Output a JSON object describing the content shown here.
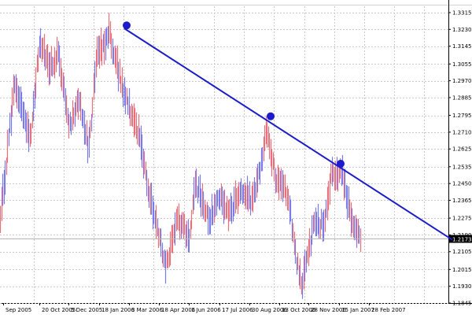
{
  "chart_data": {
    "type": "bar",
    "style": "ohlc-bars",
    "grid": true,
    "legend": "none",
    "colors": {
      "background": "#ffffff",
      "grid": "#c8c8c8",
      "up_bar": "#e8707a",
      "down_bar": "#7a7ae8",
      "trendline": "#1c1ccc",
      "marker": "#1c1ccc",
      "current_price_line": "#b4b4b4",
      "current_price_label_bg": "#000000",
      "current_price_label_fg": "#ffffff",
      "axis_text": "#000000"
    },
    "x_tick_labels": [
      "Sep 2005",
      "20 Oct 2005",
      "5 Dec 2005",
      "18 Jan 2006",
      "3 Mar 2006",
      "18 Apr 2006",
      "1 Jun 2006",
      "17 Jul 2006",
      "30 Aug 2006",
      "13 Oct 2006",
      "28 Nov 2006",
      "15 Jan 2007",
      "28 Feb 2007"
    ],
    "y_tick_labels": [
      "1.3315",
      "1.3230",
      "1.3145",
      "1.3055",
      "1.2970",
      "1.2885",
      "1.2795",
      "1.2710",
      "1.2625",
      "1.2535",
      "1.2450",
      "1.2365",
      "1.2275",
      "1.2190",
      "1.2105",
      "1.2015",
      "1.1930",
      "1.1845"
    ],
    "ylim": [
      1.1845,
      1.3315
    ],
    "current_price": "1.2173",
    "price_keyframes": [
      {
        "x": "Sep 2005",
        "y": 1.228
      },
      {
        "x": "Oct 2005",
        "y": 1.296
      },
      {
        "x": "20 Oct 2005",
        "y": 1.268
      },
      {
        "x": "Nov 2005",
        "y": 1.318
      },
      {
        "x": "Nov 2005",
        "y": 1.303
      },
      {
        "x": "5 Dec 2005",
        "y": 1.311
      },
      {
        "x": "Dec 2005",
        "y": 1.272
      },
      {
        "x": "Jan 2006",
        "y": 1.289
      },
      {
        "x": "18 Jan 2006",
        "y": 1.262
      },
      {
        "x": "Feb 2006",
        "y": 1.308
      },
      {
        "x": "3 Mar 2006",
        "y": 1.322
      },
      {
        "x": "Mar 2006",
        "y": 1.303
      },
      {
        "x": "Mar 2006",
        "y": 1.291
      },
      {
        "x": "Apr 2006",
        "y": 1.266
      },
      {
        "x": "Apr 2006",
        "y": 1.238
      },
      {
        "x": "18 Apr 2006",
        "y": 1.203
      },
      {
        "x": "May 2006",
        "y": 1.227
      },
      {
        "x": "May 2006",
        "y": 1.219
      },
      {
        "x": "1 Jun 2006",
        "y": 1.245
      },
      {
        "x": "Jun 2006",
        "y": 1.226
      },
      {
        "x": "Jul 2006",
        "y": 1.239
      },
      {
        "x": "17 Jul 2006",
        "y": 1.229
      },
      {
        "x": "Aug 2006",
        "y": 1.243
      },
      {
        "x": "30 Aug 2006",
        "y": 1.236
      },
      {
        "x": "Sep 2006",
        "y": 1.252
      },
      {
        "x": "13 Oct 2006",
        "y": 1.274
      },
      {
        "x": "Oct 2006",
        "y": 1.246
      },
      {
        "x": "Nov 2006",
        "y": 1.239
      },
      {
        "x": "Nov 2006",
        "y": 1.209
      },
      {
        "x": "28 Nov 2006",
        "y": 1.193
      },
      {
        "x": "Dec 2006",
        "y": 1.227
      },
      {
        "x": "Dec 2006",
        "y": 1.223
      },
      {
        "x": "15 Jan 2007",
        "y": 1.252
      },
      {
        "x": "Jan 2007",
        "y": 1.248
      },
      {
        "x": "Feb 2007",
        "y": 1.251
      },
      {
        "x": "Feb 2007",
        "y": 1.235
      },
      {
        "x": "28 Feb 2007",
        "y": 1.222
      },
      {
        "x": "28 Feb 2007",
        "y": 1.217
      }
    ],
    "trendline": {
      "start": {
        "x": "3 Mar 2006",
        "y": 1.3235
      },
      "end": {
        "x": "Apr 2007",
        "y": 1.2165
      }
    },
    "pivot_markers": [
      {
        "x": "3 Mar 2006",
        "y": 1.325
      },
      {
        "x": "13 Oct 2006",
        "y": 1.279
      },
      {
        "x": "15 Jan 2007",
        "y": 1.255
      }
    ]
  }
}
